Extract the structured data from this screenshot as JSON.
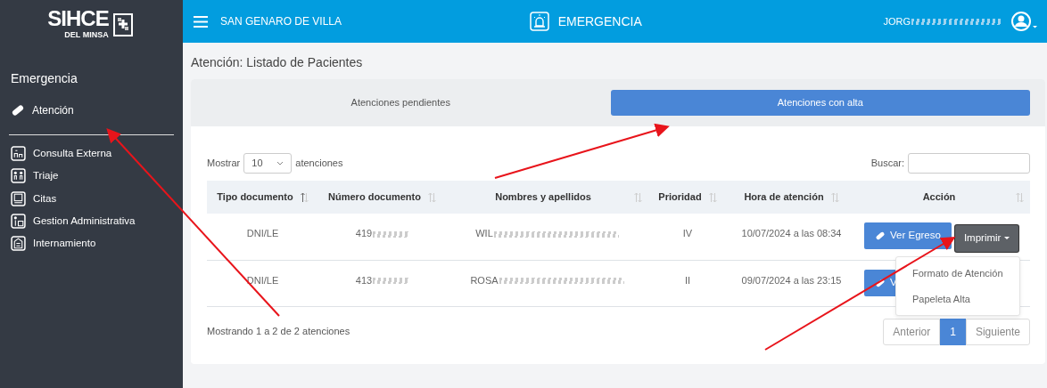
{
  "sidebar": {
    "logo": {
      "title": "SIHCE",
      "subtitle": "DEL MINSA"
    },
    "section": "Emergencia",
    "items": [
      {
        "label": "Atención",
        "selected": true
      }
    ],
    "modules": [
      {
        "label": "Consulta Externa"
      },
      {
        "label": "Triaje"
      },
      {
        "label": "Citas"
      },
      {
        "label": "Gestion Administrativa"
      },
      {
        "label": "Internamiento"
      }
    ]
  },
  "topbar": {
    "location": "SAN GENARO DE VILLA",
    "module": "EMERGENCIA",
    "user": "JORG",
    "user_redacted": true
  },
  "page_title": "Atención: Listado de Pacientes",
  "tabs": [
    {
      "label": "Atenciones pendientes",
      "selected": false
    },
    {
      "label": "Atenciones con alta",
      "selected": true
    }
  ],
  "length_menu": {
    "before": "Mostrar",
    "value": "10",
    "after": "atenciones"
  },
  "search": {
    "label": "Buscar:"
  },
  "table": {
    "columns": [
      {
        "label": "Tipo documento",
        "sorted": true
      },
      {
        "label": "Número documento",
        "sorted": false
      },
      {
        "label": "Nombres y apellidos",
        "sorted": false
      },
      {
        "label": "Prioridad",
        "sorted": false
      },
      {
        "label": "Hora de atención",
        "sorted": false
      },
      {
        "label": "Acción",
        "sorted": false
      }
    ],
    "rows": [
      {
        "cells": [
          {
            "text": "DNI/LE",
            "redacted": false
          },
          {
            "text": "419",
            "redacted": true
          },
          {
            "text": "WIL",
            "redacted": true
          },
          {
            "text": "IV",
            "redacted": false
          },
          {
            "text": "10/07/2024 a las 08:34",
            "redacted": false
          }
        ],
        "actions": [
          {
            "kind": "primary",
            "label": "Ver Egreso"
          },
          {
            "kind": "dropdown",
            "label": "Imprimir"
          }
        ]
      },
      {
        "cells": [
          {
            "text": "DNI/LE",
            "redacted": false
          },
          {
            "text": "413",
            "redacted": true
          },
          {
            "text": "ROSA",
            "redacted": true
          },
          {
            "text": "II",
            "redacted": false
          },
          {
            "text": "09/07/2024 a las 23:15",
            "redacted": false
          }
        ],
        "actions": [
          {
            "kind": "primary",
            "label": "V"
          }
        ]
      }
    ]
  },
  "dropdown": {
    "items": [
      "Formato de Atención",
      "Papeleta Alta"
    ]
  },
  "info": "Mostrando 1 a 2 de 2 atenciones",
  "pagination": [
    {
      "label": "Anterior",
      "selected": false
    },
    {
      "label": "1",
      "selected": true
    },
    {
      "label": "Siguiente",
      "selected": false
    }
  ]
}
